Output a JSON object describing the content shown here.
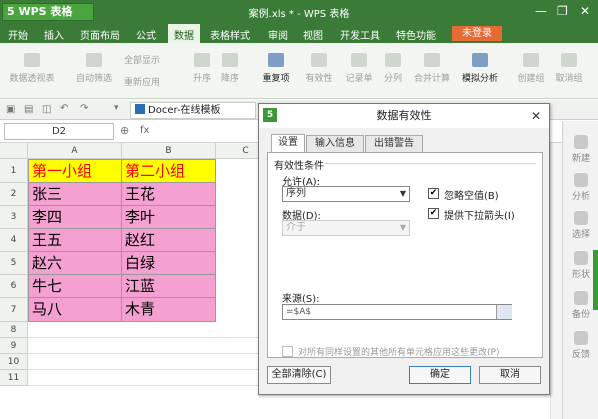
{
  "app": {
    "logo": "5 WPS 表格",
    "doc_title": "案例.xls * - WPS 表格"
  },
  "menu": {
    "items": [
      "开始",
      "插入",
      "页面布局",
      "公式",
      "数据",
      "表格样式",
      "审阅",
      "视图",
      "开发工具",
      "特色功能"
    ],
    "active": "数据",
    "login": "未登录"
  },
  "ribbon": {
    "pivot": "数据透视表",
    "autofilter": "自动筛选",
    "show_all": "全部显示",
    "reapply": "重新应用",
    "asc": "升序",
    "desc": "降序",
    "duplicates": "重复项",
    "validity": "有效性",
    "record": "记录单",
    "split": "分列",
    "consolidate": "合并计算",
    "whatif": "模拟分析",
    "group": "创建组",
    "ungroup": "取消组"
  },
  "quickbar": {
    "tab": "Docer-在线模板"
  },
  "formula": {
    "namebox": "D2",
    "fx": "fx"
  },
  "sheet": {
    "columns": [
      "A",
      "B",
      "C"
    ],
    "rows": [
      "1",
      "2",
      "3",
      "4",
      "5",
      "6",
      "7",
      "8",
      "9",
      "10",
      "11"
    ],
    "header": [
      "第一小组",
      "第二小组"
    ],
    "data": [
      [
        "张三",
        "王花"
      ],
      [
        "李四",
        "李叶"
      ],
      [
        "王五",
        "赵红"
      ],
      [
        "赵六",
        "白绿"
      ],
      [
        "牛七",
        "江蓝"
      ],
      [
        "马八",
        "木青"
      ]
    ]
  },
  "dialog": {
    "title": "数据有效性",
    "icon": "5",
    "tabs": [
      "设置",
      "输入信息",
      "出错警告"
    ],
    "group_label": "有效性条件",
    "allow_label": "允许(A):",
    "allow_value": "序列",
    "data_label": "数据(D):",
    "data_value": "介于",
    "ignore_blank": "忽略空值(B)",
    "dropdown": "提供下拉箭头(I)",
    "source_label": "来源(S):",
    "source_value": "=$A$",
    "apply_all": "对所有同样设置的其他所有单元格应用这些更改(P)",
    "clear_all": "全部清除(C)",
    "ok": "确定",
    "cancel": "取消"
  },
  "sidebar": {
    "items": [
      "新建",
      "分析",
      "选择",
      "形状",
      "备份",
      "反馈"
    ]
  }
}
